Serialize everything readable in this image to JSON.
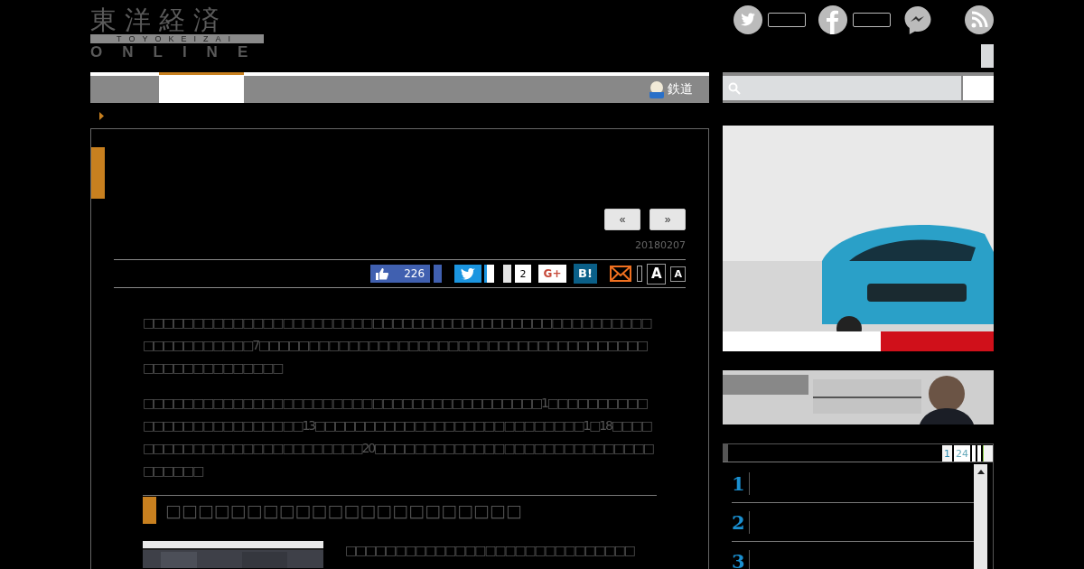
{
  "header": {
    "logo": {
      "title": "東洋経済",
      "subtitle": "TOYOKEIZAI",
      "tagline": "ONLINE"
    },
    "social": [
      {
        "kind": "twitter",
        "counter": true
      },
      {
        "kind": "facebook",
        "counter": true
      },
      {
        "kind": "messenger",
        "counter": false
      },
      {
        "kind": "rss",
        "counter": false
      }
    ]
  },
  "nav": {
    "tabs": [
      {
        "selected": false
      },
      {
        "selected": true
      }
    ],
    "link": "鉄道"
  },
  "article": {
    "pager": [
      "«",
      "»"
    ],
    "date": "20180207",
    "share": {
      "like_count": "226",
      "comment_count": "2",
      "gplus": "G+",
      "hatena": "B!",
      "font_sizes": [
        "A",
        "A"
      ]
    },
    "paragraphs": [
      " □□□□□□□□□□□□□□□□□□□□□□□□□□□□□□□□□□□□□□□□□□□□□□□□□□□□□□□□□□□□□□7□□□□□□□□□□□□□□□□□□□□□□□□□□□□□□□□□□□□□□□□□□□□□□□□□□□□□",
      " □□□□□□□□□□□□□□□□□□□□□□□□□□□□□□□□□□□□□□□□1□□□□□□□□□□□□□□□□□□□□□□□□□□13□□□□□□□□□□□□□□□□□□□□□□□□□□□1□18□□□□□□□□□□□□□□□□□□□□□□□□□□20□□□□□□□□□□□□□□□□□□□□□□□□□□□□□□□□□□"
    ],
    "heading": "□□□□□□□□□□□□□□□□□□□□□□",
    "after_image": "□□□□□□□□□□□□□□□□□□□□□□□□□□□□□"
  },
  "ranking": {
    "tabs": [
      {
        "label": "1",
        "selected": true
      },
      {
        "label": "24",
        "selected": false
      }
    ],
    "ranks": [
      "1",
      "2",
      "3"
    ]
  }
}
